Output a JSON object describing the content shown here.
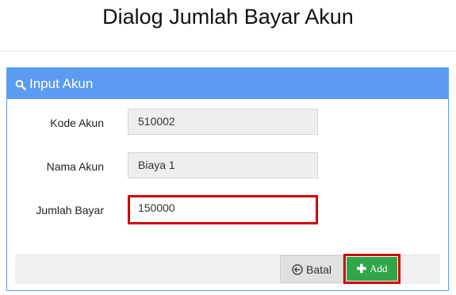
{
  "dialog": {
    "title": "Dialog Jumlah Bayar Akun"
  },
  "panel": {
    "heading": "Input Akun",
    "heading_icon": "search-icon",
    "accent": "#5b9cf2"
  },
  "form": {
    "kode_akun": {
      "label": "Kode Akun",
      "value": "510002"
    },
    "nama_akun": {
      "label": "Nama Akun",
      "value": "Biaya 1"
    },
    "jumlah_bayar": {
      "label": "Jumlah Bayar",
      "value": "150000"
    }
  },
  "buttons": {
    "batal": {
      "label": "Batal",
      "icon": "circle-arrow-left-icon"
    },
    "add": {
      "label": "Add",
      "icon": "plus-icon",
      "color": "#2fa648"
    }
  },
  "highlight_color": "#d40000"
}
